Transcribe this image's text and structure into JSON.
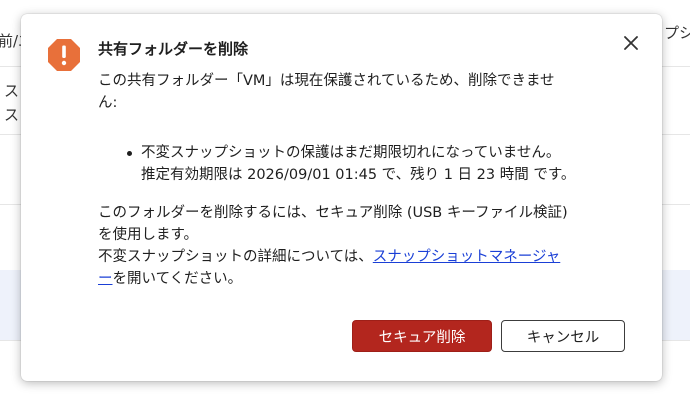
{
  "background": {
    "header_left_text": "前/エ",
    "header_right_text": "プシ",
    "row1_left_line1": "ス",
    "row1_left_line2": "ス"
  },
  "dialog": {
    "title": "共有フォルダーを削除",
    "icon": "warning-icon",
    "icon_color": "#e8703a",
    "close_icon": "close-icon",
    "paragraph1_line1": "この共有フォルダー「VM」は現在保護されているため、削除できませ",
    "paragraph1_line2": "ん:",
    "bullet_line1": "不変スナップショットの保護はまだ期限切れになっていません。",
    "bullet_line2": "推定有効期限は 2026/09/01 01:45 で、残り 1 日 23 時間 です。",
    "paragraph2_line1": "このフォルダーを削除するには、セキュア削除 (USB キーファイル検証)",
    "paragraph2_line2": "を使用します。",
    "paragraph3_prefix": "不変スナップショットの詳細については、",
    "link_part1": "スナップショットマネージャ",
    "link_part2": "ー",
    "paragraph3_suffix": "を開いてください。",
    "primary_button": "セキュア削除",
    "secondary_button": "キャンセル",
    "primary_color": "#b3261e",
    "link_color": "#1a3fd6"
  }
}
